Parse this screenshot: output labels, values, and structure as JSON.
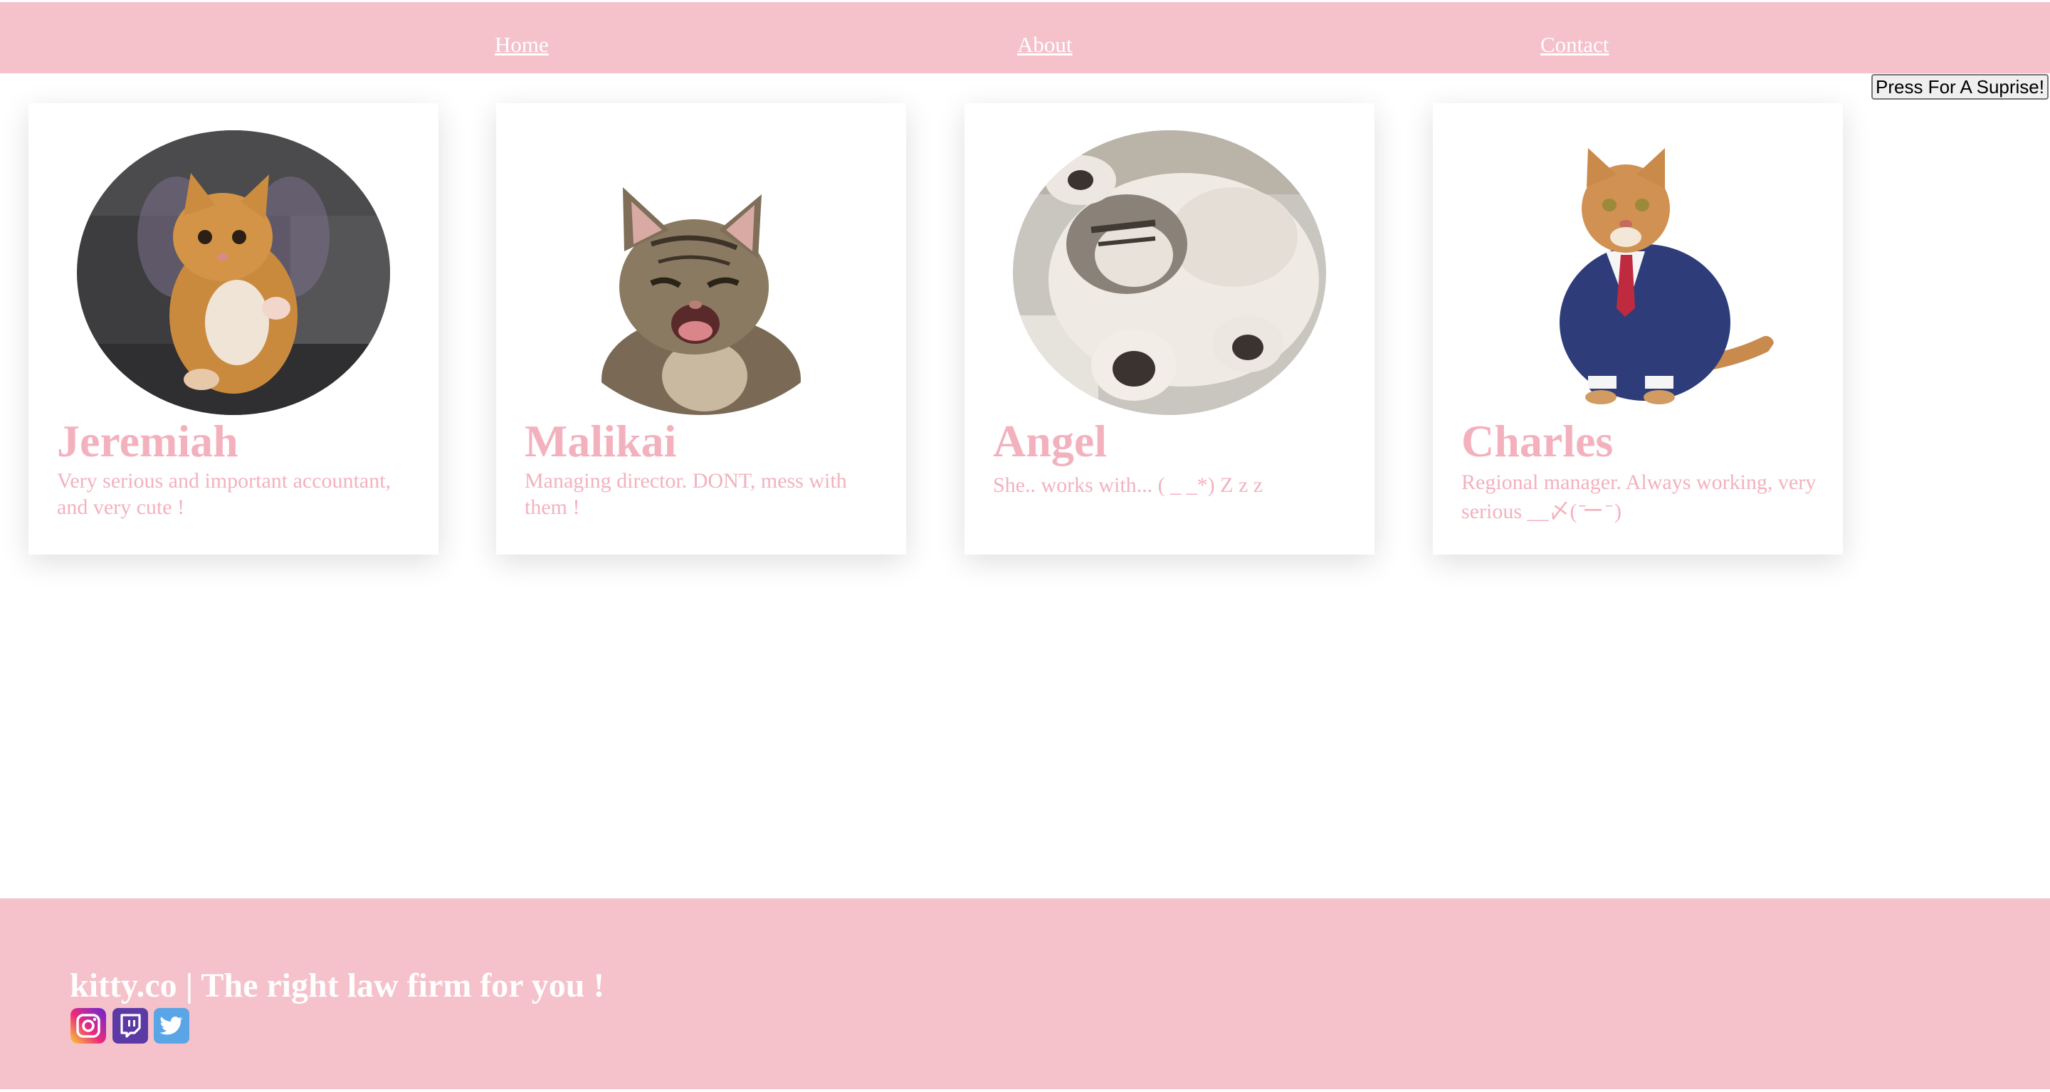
{
  "nav": {
    "home": "Home",
    "about": "About",
    "contact": "Contact"
  },
  "surprise_button": "Press For A Suprise!",
  "cards": [
    {
      "name": "Jeremiah",
      "desc": "Very serious and important accountant, and very cute !"
    },
    {
      "name": "Malikai",
      "desc": "Managing director. DONT, mess with them !"
    },
    {
      "name": "Angel",
      "desc": "She.. works with... ( _  _*) Z z z"
    },
    {
      "name": "Charles",
      "desc": "Regional manager. Always working, very serious __〆( ̄ー ̄ )"
    }
  ],
  "footer": {
    "title": "kitty.co | The right law firm for you !",
    "social": [
      "instagram-icon",
      "twitch-icon",
      "twitter-icon"
    ]
  },
  "colors": {
    "accent": "#f5c1cb",
    "text_pink": "#f3b1be",
    "white": "#ffffff"
  }
}
